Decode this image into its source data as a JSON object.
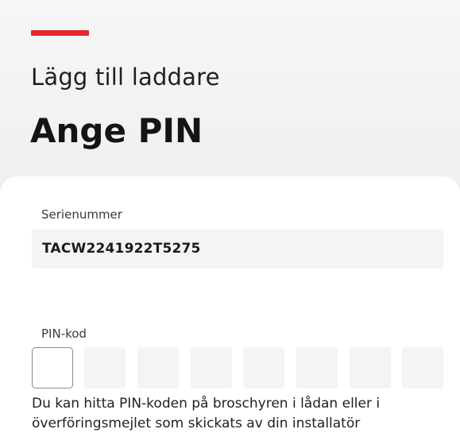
{
  "header": {
    "subtitle": "Lägg till laddare",
    "title": "Ange PIN",
    "accent_color": "#e4262c"
  },
  "serial": {
    "label": "Serienummer",
    "value": "TACW2241922T5275"
  },
  "pin": {
    "label": "PIN-kod",
    "cells": [
      "",
      "",
      "",
      "",
      "",
      "",
      "",
      ""
    ],
    "active_index": 0
  },
  "help_text": "Du kan hitta PIN-koden på broschyren i lådan eller i överföringsmejlet som skickats av din installatör"
}
